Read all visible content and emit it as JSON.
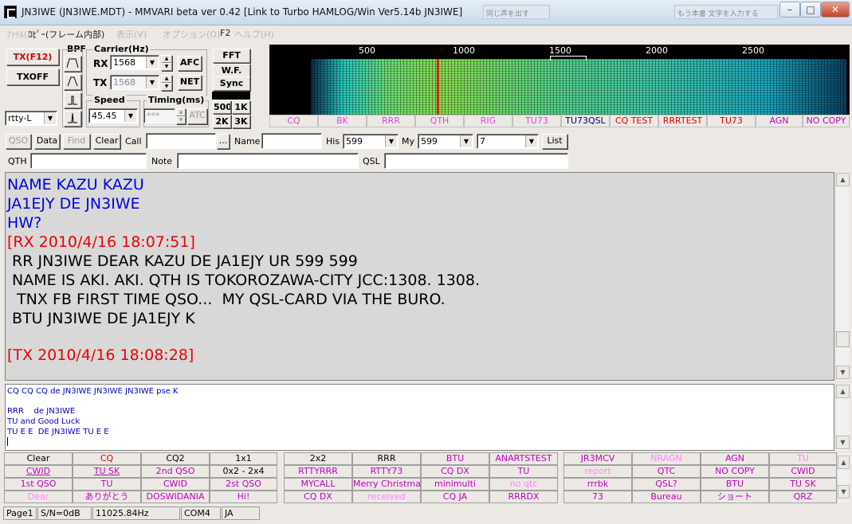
{
  "window": {
    "title": "JN3IWE (JN3IWE.MDT) - MMVARI beta ver 0.42 [Link to Turbo HAMLOG/Win Ver5.14b JN3IWE]",
    "bg_tab_1": "同じ声を出す",
    "bg_tab_2": "もう本書 文字を入力する"
  },
  "menu": [
    {
      "label": "ﾌｧｲﾙ(F)"
    },
    {
      "label": "ｺﾋﾟｰ(フレーム内部)"
    },
    {
      "label": "表示(V)"
    },
    {
      "label": "オプション(O)"
    },
    {
      "label": "F2"
    },
    {
      "label": "ヘルプ(H)"
    }
  ],
  "controls": {
    "tx_button": "TX(F12)",
    "txoff_button": "TXOFF",
    "bpf_label": "BPF",
    "carrier_label": "Carrier(Hz)",
    "rx_label": "RX",
    "tx_label": "TX",
    "rx_freq": "1568",
    "tx_freq": "1568",
    "afc_button": "AFC",
    "net_button": "NET",
    "mode": "rtty-L",
    "speed_label": "Speed",
    "speed_value": "45.45",
    "timing_label": "Timing(ms)",
    "timing_value": "***",
    "atc_button": "ATC",
    "fft_button": "FFT",
    "wf_button": "W.F.",
    "sync_button": "Sync",
    "span_buttons": [
      "500",
      "1K",
      "2K",
      "3K"
    ]
  },
  "spectrum": {
    "scale": [
      "500",
      "1000",
      "1500",
      "2000",
      "2500"
    ],
    "macros": [
      {
        "label": "CQ",
        "color": "#e040e0"
      },
      {
        "label": "BK",
        "color": "#e040e0"
      },
      {
        "label": "RRR",
        "color": "#e040e0"
      },
      {
        "label": "QTH",
        "color": "#e040e0"
      },
      {
        "label": "RIG",
        "color": "#e040e0"
      },
      {
        "label": "TU73",
        "color": "#e040e0"
      },
      {
        "label": "TU73QSL",
        "color": "#000080"
      },
      {
        "label": "CQ TEST",
        "color": "#e00000"
      },
      {
        "label": "RRRTEST",
        "color": "#e00000"
      },
      {
        "label": "TU73",
        "color": "#e00000"
      },
      {
        "label": "AGN",
        "color": "#c000c0"
      },
      {
        "label": "NO COPY",
        "color": "#c000c0"
      }
    ]
  },
  "log": {
    "qso_button": "QSO",
    "data_button": "Data",
    "find_button": "Find",
    "clear_button": "Clear",
    "call_label": "Call",
    "call_value": "",
    "ellipsis_button": "...",
    "name_label": "Name",
    "name_value": "",
    "his_label": "His",
    "his_value": "599",
    "my_label": "My",
    "my_value": "599",
    "band_value": "7",
    "list_button": "List",
    "qth_label": "QTH",
    "note_label": "Note",
    "qsl_label": "QSL"
  },
  "rx_lines": [
    {
      "text": "NAME KAZU KAZU",
      "cls": "rx-blue"
    },
    {
      "text": "JA1EJY DE JN3IWE",
      "cls": "rx-blue"
    },
    {
      "text": "HW?",
      "cls": "rx-blue"
    },
    {
      "text": "[RX 2010/4/16 18:07:51]",
      "cls": "rx-red"
    },
    {
      "text": " RR JN3IWE DEAR KAZU DE JA1EJY UR 599 599",
      "cls": "rx-black"
    },
    {
      "text": " NAME IS AKI. AKI. QTH IS TOKOROZAWA-CITY JCC:1308. 1308.",
      "cls": "rx-black"
    },
    {
      "text": "  TNX FB FIRST TIME QSO...  MY QSL-CARD VIA THE BURO.",
      "cls": "rx-black"
    },
    {
      "text": " BTU JN3IWE DE JA1EJY K",
      "cls": "rx-black"
    },
    {
      "text": "",
      "cls": "rx-black"
    },
    {
      "text": "[TX 2010/4/16 18:08:28]",
      "cls": "rx-red"
    }
  ],
  "tx_lines": [
    "CQ CQ CQ de JN3IWE JN3IWE JN3IWE pse K",
    "",
    "RRR    de JN3IWE",
    "TU and Good Luck",
    "TU E E  DE JN3IWE TU E E"
  ],
  "macro_grid": [
    [
      {
        "label": "Clear",
        "color": "#000000"
      },
      {
        "label": "CQ",
        "color": "#e00000"
      },
      {
        "label": "CQ2",
        "color": "#000000"
      },
      {
        "label": "1x1",
        "color": "#000000"
      },
      {
        "label": "2x2",
        "color": "#000000"
      },
      {
        "label": "RRR",
        "color": "#000000"
      },
      {
        "label": "BTU",
        "color": "#c000c0"
      },
      {
        "label": "ANARTSTEST",
        "color": "#c000c0"
      },
      {
        "label": "JR3MCV",
        "color": "#c000c0"
      },
      {
        "label": "NRAGN",
        "color": "#ff80ff"
      },
      {
        "label": "AGN",
        "color": "#c000c0"
      },
      {
        "label": "TU",
        "color": "#ff80ff"
      }
    ],
    [
      {
        "label": "CWID",
        "color": "#c000c0",
        "u": true
      },
      {
        "label": "TU SK",
        "color": "#c000c0",
        "u": true
      },
      {
        "label": "2nd QSO",
        "color": "#c000c0"
      },
      {
        "label": "0x2 - 2x4",
        "color": "#000000"
      },
      {
        "label": "RTTYRRR",
        "color": "#c000c0"
      },
      {
        "label": "RTTY73",
        "color": "#c000c0"
      },
      {
        "label": "CQ DX",
        "color": "#c000c0"
      },
      {
        "label": "TU",
        "color": "#c000c0"
      },
      {
        "label": "report",
        "color": "#ff80ff"
      },
      {
        "label": "QTC",
        "color": "#c000c0"
      },
      {
        "label": "NO COPY",
        "color": "#c000c0"
      },
      {
        "label": "CWID",
        "color": "#c000c0"
      }
    ],
    [
      {
        "label": "1st QSO",
        "color": "#c000c0"
      },
      {
        "label": "TU",
        "color": "#c000c0"
      },
      {
        "label": "CWID",
        "color": "#c000c0"
      },
      {
        "label": "2st QSO",
        "color": "#c000c0"
      },
      {
        "label": "MYCALL",
        "color": "#c000c0"
      },
      {
        "label": "Merry Christmas",
        "color": "#c000c0"
      },
      {
        "label": "minimulti",
        "color": "#c000c0"
      },
      {
        "label": "no qtc",
        "color": "#ff80ff"
      },
      {
        "label": "rrrbk",
        "color": "#c000c0"
      },
      {
        "label": "QSL?",
        "color": "#c000c0"
      },
      {
        "label": "BTU",
        "color": "#c000c0"
      },
      {
        "label": "TU SK",
        "color": "#c000c0"
      }
    ],
    [
      {
        "label": "Dear",
        "color": "#ff80ff"
      },
      {
        "label": "ありがとう",
        "color": "#c000c0"
      },
      {
        "label": "DOSWIDANIA",
        "color": "#c000c0"
      },
      {
        "label": "Hi!",
        "color": "#c000c0"
      },
      {
        "label": "CQ DX",
        "color": "#c000c0"
      },
      {
        "label": "received",
        "color": "#ff80ff"
      },
      {
        "label": "CQ JA",
        "color": "#c000c0"
      },
      {
        "label": "RRRDX",
        "color": "#c000c0"
      },
      {
        "label": "73",
        "color": "#c000c0"
      },
      {
        "label": "Bureau",
        "color": "#c000c0"
      },
      {
        "label": "ショート",
        "color": "#c000c0"
      },
      {
        "label": "QRZ",
        "color": "#c000c0"
      }
    ]
  ],
  "status": {
    "page": "Page1",
    "sn": "S/N=0dB",
    "rate": "11025.84Hz",
    "port": "COM4",
    "lang": "JA"
  }
}
